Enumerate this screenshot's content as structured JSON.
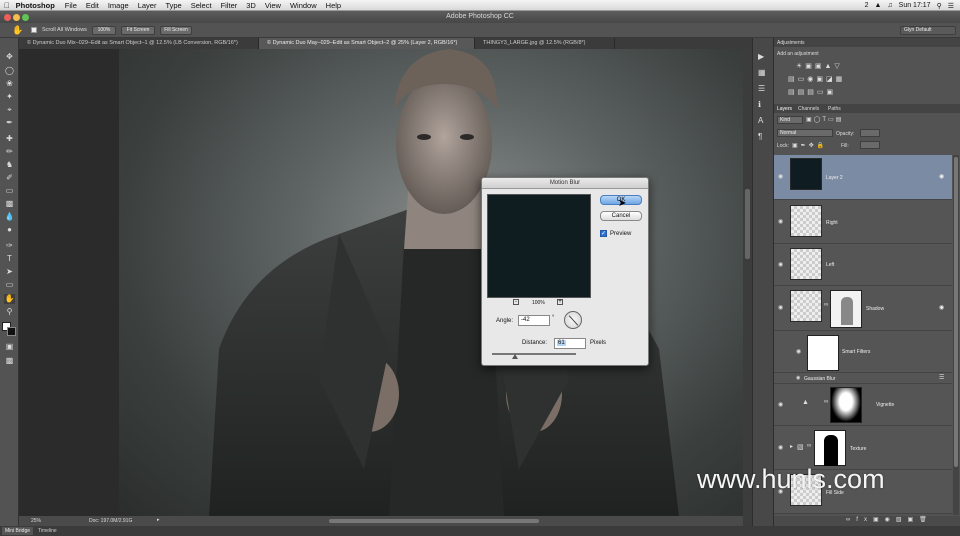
{
  "menubar": {
    "apple": "",
    "app_name": "Photoshop",
    "items": [
      "File",
      "Edit",
      "Image",
      "Layer",
      "Type",
      "Select",
      "Filter",
      "3D",
      "View",
      "Window",
      "Help"
    ],
    "clock": "Sun 17:17",
    "badge": "2"
  },
  "window": {
    "title": "Adobe Photoshop CC"
  },
  "options_bar": {
    "checkbox_label": "Scroll All Windows",
    "btn_100": "100%",
    "btn_fit": "Fit Screen",
    "btn_fill": "Fill Screen",
    "workspace": "Glyn Default"
  },
  "doc_tabs": [
    "© Dynamic Duo Mix–029–Edit as Smart Object–1 @ 12.5% (LB Conversion, RGB/16*)",
    "© Dynamic Duo May–029–Edit as Smart Object–2 @ 25% (Layer 2, RGB/16*)",
    "THINGY3_LARGE.jpg @ 12.5% (RGB/8*)"
  ],
  "status": {
    "zoom": "25%",
    "doc": "Doc: 197.0M/2.91G"
  },
  "bottom_tabs": [
    "Mini Bridge",
    "Timeline"
  ],
  "panels": {
    "adjustments_tab": "Adjustments",
    "adjustments_hint": "Add an adjustment",
    "layer_tabs": [
      "Layers",
      "Channels",
      "Paths"
    ],
    "kind": "Kind",
    "blend": "Normal",
    "opacity_label": "Opacity:",
    "lock_label": "Lock:",
    "fill_label": "Fill:",
    "layers": [
      {
        "name": "Layer 2"
      },
      {
        "name": "Right"
      },
      {
        "name": "Left"
      },
      {
        "name": "Shadow"
      },
      {
        "name": "Smart Filters"
      },
      {
        "name": "Gaussian Blur"
      },
      {
        "name": "Vignette"
      },
      {
        "name": "Texture"
      },
      {
        "name": "Fill Side"
      }
    ]
  },
  "dialog": {
    "title": "Motion Blur",
    "ok": "OK",
    "cancel": "Cancel",
    "preview_label": "Preview",
    "zoom": "100%",
    "angle_label": "Angle:",
    "angle_value": "-42",
    "angle_unit": "°",
    "distance_label": "Distance:",
    "distance_value": "61",
    "distance_unit": "Pixels"
  },
  "watermark": "www.hunls.com",
  "colors": {
    "ui_dark": "#535353",
    "selection_blue": "#7a8ba3",
    "ok_blue": "#6ea6e4"
  }
}
